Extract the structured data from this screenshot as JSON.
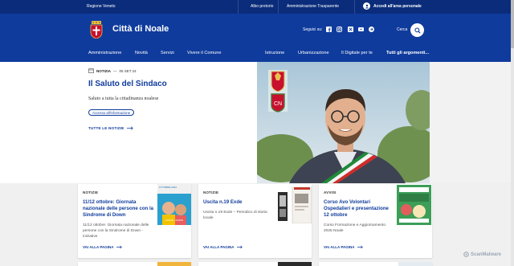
{
  "topbar": {
    "region": "Regione Veneto",
    "links": [
      "Albo pretorio",
      "Amministrazione Trasparente"
    ],
    "login": "Accedi all'area personale"
  },
  "header": {
    "title": "Città di Noale",
    "follow_label": "Seguici su:",
    "social_icons": [
      "facebook-icon",
      "instagram-icon",
      "x-icon",
      "youtube-icon",
      "telegram-icon"
    ],
    "search_label": "Cerca"
  },
  "nav": {
    "left": [
      "Amministrazione",
      "Novità",
      "Servizi",
      "Vivere il Comune"
    ],
    "right": [
      "Istruzione",
      "Urbanizzazione",
      "Il Digitale per te",
      "Tutti gli argomenti..."
    ]
  },
  "hero": {
    "category": "NOTIZIA",
    "date": "05 SET 24",
    "title": "Il Saluto del Sindaco",
    "subtitle": "Saluto a tutta la cittadinanza noalese",
    "tag": "Accesso all'informazione",
    "all_news": "TUTTE LE NOTIZIE"
  },
  "cards": [
    {
      "kicker": "NOTIZIE",
      "title_lines": [
        "11/12 ottobre: Giornata",
        "nazionale delle persone con la",
        "Sindrome di Down"
      ],
      "desc_lines": [
        "11/12 ottobre: Giornata nazionale delle",
        "persone con la Sindrome di Down -",
        "iniziative"
      ],
      "more": "VAI ALLA PAGINA",
      "thumb_text": [
        "OTTOBRE 2024",
        "CAFFÈ · DOWN"
      ]
    },
    {
      "kicker": "NOTIZIE",
      "title_lines": [
        "Uscita n.19 Exde"
      ],
      "desc_lines": [
        "Uscita n.19 Exde – Periodico di storia",
        "locale"
      ],
      "more": "VAI ALLA PAGINA"
    },
    {
      "kicker": "AVVISI",
      "title_lines": [
        "Corso Avo Volontari",
        "Ospedalieri e presentazione",
        "12 ottobre"
      ],
      "desc_lines": [
        "Corso Formazione e Aggiornamento",
        "2025 Noale"
      ],
      "more": "VAI ALLA PAGINA"
    }
  ],
  "watermark": "ScanMalware",
  "colors": {
    "primary": "#0f3b9c",
    "topbar": "#0a2c7a"
  }
}
